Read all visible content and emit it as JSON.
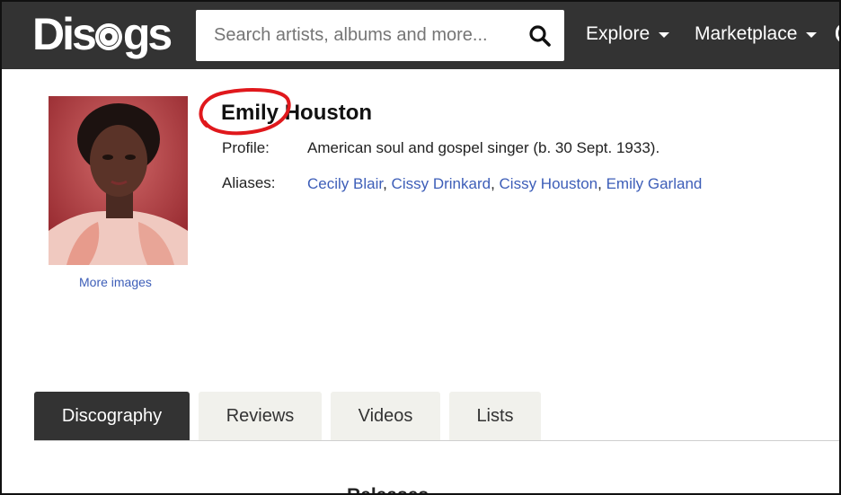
{
  "header": {
    "logo_text_left": "Dis",
    "logo_text_right": "gs",
    "search_placeholder": "Search artists, albums and more...",
    "nav": [
      {
        "label": "Explore"
      },
      {
        "label": "Marketplace"
      }
    ]
  },
  "artist": {
    "name": "Emily Houston",
    "more_images": "More images",
    "profile_label": "Profile:",
    "profile_value": "American soul and gospel singer (b. 30 Sept. 1933).",
    "aliases_label": "Aliases:",
    "aliases": [
      "Cecily Blair",
      "Cissy Drinkard",
      "Cissy Houston",
      "Emily Garland"
    ],
    "alias_separator": ", "
  },
  "tabs": [
    {
      "label": "Discography",
      "active": true
    },
    {
      "label": "Reviews",
      "active": false
    },
    {
      "label": "Videos",
      "active": false
    },
    {
      "label": "Lists",
      "active": false
    }
  ],
  "releases_heading": "Releases",
  "colors": {
    "header_bg": "#333333",
    "link": "#3d5eb8",
    "annotation": "#e0181c",
    "tab_inactive_bg": "#f1f1ec"
  }
}
